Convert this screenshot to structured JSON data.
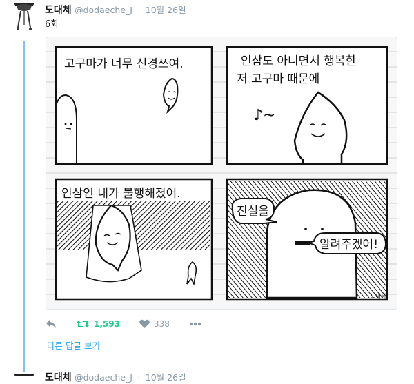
{
  "tweet": {
    "author_name": "도대체",
    "handle": "@dodaeche_J",
    "time": "10월 26일",
    "text": "6화",
    "comic_panels": [
      {
        "caption": "고구마가 너무 신경쓰여."
      },
      {
        "caption_line1": "인삼도 아니면서 행복한",
        "caption_line2": "저 고구마 때문에",
        "sound": "♪~"
      },
      {
        "caption": "인삼인 내가 불행해졌어."
      },
      {
        "bubble1": "진실을",
        "bubble2": "알려주겠어!",
        "signature": "도대체"
      }
    ],
    "actions": {
      "reply_icon": "reply-icon",
      "retweet_count": "1,593",
      "like_count": "338",
      "more_icon": "more-icon"
    },
    "more_replies_label": "다른 답글 보기",
    "colors": {
      "thread_line": "#7fc4e8",
      "retweet_green": "#19cf86",
      "link_blue": "#1da1f2",
      "muted": "#8899a6"
    }
  },
  "next_tweet": {
    "author_name": "도대체",
    "handle": "@dodaeche_J",
    "time": "10월 26일"
  }
}
